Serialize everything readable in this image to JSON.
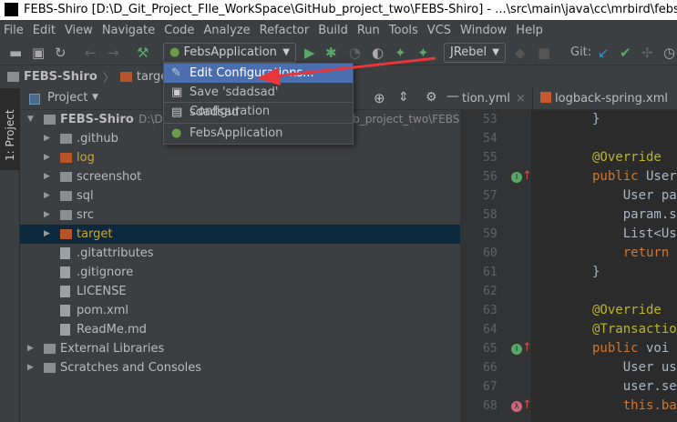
{
  "window": {
    "title": "FEBS-Shiro [D:\\D_Git_Project_FIle_WorkSpace\\GitHub_project_two\\FEBS-Shiro] - ...\\src\\main\\java\\cc\\mrbird\\febs\\system\\ser",
    "logo": "IJ"
  },
  "menu": [
    "File",
    "Edit",
    "View",
    "Navigate",
    "Code",
    "Analyze",
    "Refactor",
    "Build",
    "Run",
    "Tools",
    "VCS",
    "Window",
    "Help"
  ],
  "toolbar": {
    "run_config": "FebsApplication",
    "jrebel": "JRebel",
    "git_label": "Git:"
  },
  "breadcrumb": [
    "FEBS-Shiro",
    "target"
  ],
  "left_tab": "1: Project",
  "project_panel": {
    "title": "Project"
  },
  "tree": [
    {
      "label": "FEBS-Shiro",
      "extra": "D:\\D_Git_Project_FIle_WorkSpace\\GitHub_project_two\\FEBS-Shiro",
      "level": 0,
      "expanded": true,
      "bold": true
    },
    {
      "label": ".github",
      "level": 1
    },
    {
      "label": "log",
      "level": 1,
      "color": "#c9a63c"
    },
    {
      "label": "screenshot",
      "level": 1
    },
    {
      "label": "sql",
      "level": 1
    },
    {
      "label": "src",
      "level": 1
    },
    {
      "label": "target",
      "level": 1,
      "color": "#c9a63c",
      "selected": true
    },
    {
      "label": ".gitattributes",
      "level": 1,
      "file": true
    },
    {
      "label": ".gitignore",
      "level": 1,
      "file": true
    },
    {
      "label": "LICENSE",
      "level": 1,
      "file": true
    },
    {
      "label": "pom.xml",
      "level": 1,
      "file": true
    },
    {
      "label": "ReadMe.md",
      "level": 1,
      "file": true
    },
    {
      "label": "External Libraries",
      "level": 0
    },
    {
      "label": "Scratches and Consoles",
      "level": 0
    }
  ],
  "editor_tabs": [
    "tion.yml",
    "logback-spring.xml"
  ],
  "code_lines": [
    {
      "n": "53",
      "t": "}"
    },
    {
      "n": "54",
      "t": ""
    },
    {
      "n": "55",
      "t": "@Override",
      "ann": true
    },
    {
      "n": "56",
      "t": "public User",
      "kw": "public",
      "rest": " User",
      "mark": "I"
    },
    {
      "n": "57",
      "t": "    User pa"
    },
    {
      "n": "58",
      "t": "    param.s"
    },
    {
      "n": "59",
      "t": "    List<Us"
    },
    {
      "n": "60",
      "t": "    return",
      "kwonly": true
    },
    {
      "n": "61",
      "t": "}"
    },
    {
      "n": "62",
      "t": ""
    },
    {
      "n": "63",
      "t": "@Override",
      "ann": true
    },
    {
      "n": "64",
      "t": "@Transactio",
      "ann": true
    },
    {
      "n": "65",
      "t": "public voi",
      "kw": "public",
      "rest": " voi",
      "mark": "I"
    },
    {
      "n": "66",
      "t": "    User us"
    },
    {
      "n": "67",
      "t": "    user.se"
    },
    {
      "n": "68",
      "t": "    this.ba",
      "kwonly": true,
      "mark": "λ"
    }
  ],
  "dropdown": {
    "items": [
      {
        "label": "Edit Configurations...",
        "icon": "pencil-icon",
        "highlighted": true
      },
      {
        "label": "Save 'sdadsad' Configuration",
        "icon": "save-icon"
      },
      {
        "label": "sdadsad",
        "icon": "config-icon"
      },
      {
        "label": "FebsApplication",
        "icon": "spring-boot-icon"
      }
    ]
  },
  "colors": {
    "highlight": "#4b6eaf",
    "arrow": "#e8363b",
    "bg": "#3c3f41"
  }
}
